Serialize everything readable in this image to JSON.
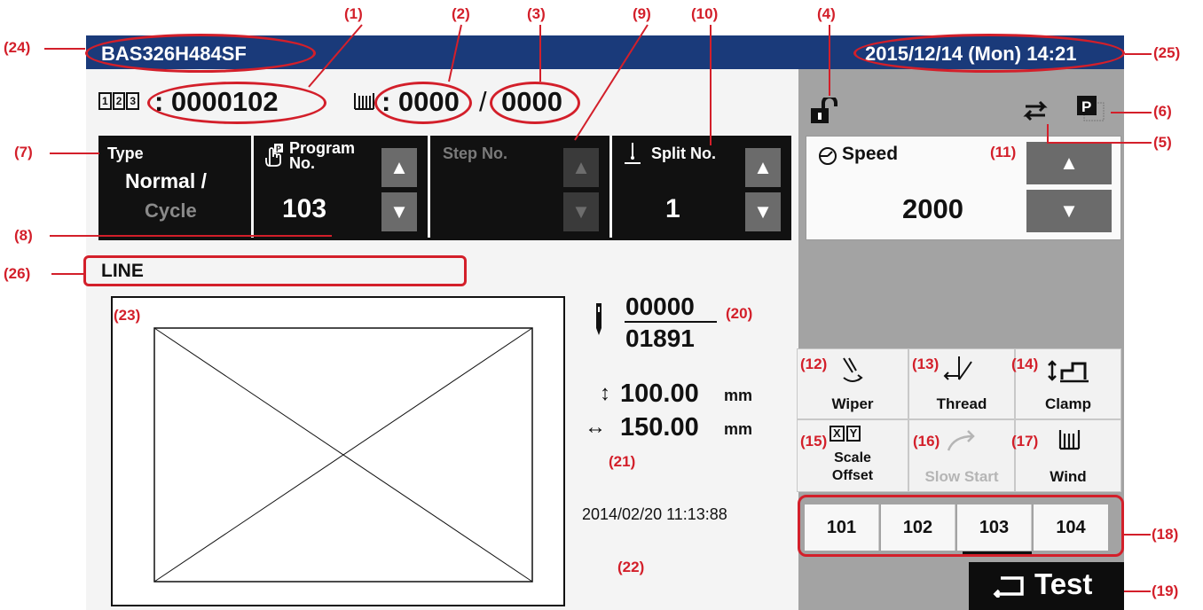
{
  "header": {
    "machine_name": "BAS326H484SF",
    "datetime": "2015/12/14 (Mon) 14:21"
  },
  "counters": {
    "count_icon_text": "123",
    "sewing_count": ": 0000102",
    "bobbin_count": ": 0000",
    "separator": "/",
    "bobbin_total": "0000"
  },
  "fields": {
    "type": {
      "label": "Type",
      "value_line1": "Normal /",
      "value_line2": "Cycle"
    },
    "program": {
      "label_line1": "Program",
      "label_line2": "No.",
      "value": "103"
    },
    "step": {
      "label": "Step No.",
      "value": ""
    },
    "split": {
      "label": "Split No.",
      "value": "1"
    }
  },
  "speed": {
    "label": "Speed",
    "value": "2000"
  },
  "pattern": {
    "name": "LINE"
  },
  "stitch": {
    "current": "00000",
    "total": "01891"
  },
  "size": {
    "height_value": "100.00",
    "width_value": "150.00",
    "unit": "mm"
  },
  "timestamp": "2014/02/20 11:13:88",
  "functions": {
    "wiper": "Wiper",
    "thread": "Thread",
    "clamp": "Clamp",
    "scale_offset_line1": "Scale",
    "scale_offset_line2": "Offset",
    "slow_start": "Slow Start",
    "wind": "Wind"
  },
  "direct_programs": [
    "101",
    "102",
    "103",
    "104"
  ],
  "test_button": "Test",
  "callouts": {
    "c1": "(1)",
    "c2": "(2)",
    "c3": "(3)",
    "c4": "(4)",
    "c5": "(5)",
    "c6": "(6)",
    "c7": "(7)",
    "c8": "(8)",
    "c9": "(9)",
    "c10": "(10)",
    "c11": "(11)",
    "c12": "(12)",
    "c13": "(13)",
    "c14": "(14)",
    "c15": "(15)",
    "c16": "(16)",
    "c17": "(17)",
    "c18": "(18)",
    "c19": "(19)",
    "c20": "(20)",
    "c21": "(21)",
    "c22": "(22)",
    "c23": "(23)",
    "c24": "(24)",
    "c25": "(25)",
    "c26": "(26)"
  },
  "colors": {
    "title_bar": "#1a3a7a",
    "callout_red": "#d31f2a",
    "panel_black": "#111111",
    "side_gray": "#a3a3a3"
  }
}
